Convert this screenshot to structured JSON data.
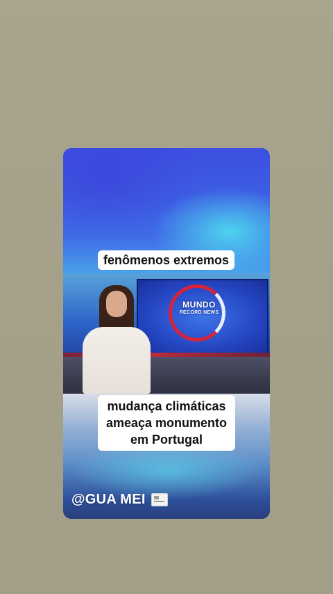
{
  "story": {
    "caption_top": "fenômenos extremos",
    "caption_bottom": "mudança climáticas ameaça monumento em Portugal",
    "video_logo": {
      "line1": "MUNDO",
      "line2": "RECORD NEWS"
    },
    "watermark": "@GUA MEI",
    "watermark_icon": "newspaper-icon"
  },
  "colors": {
    "background": "#a6a28a",
    "caption_bg": "#ffffff",
    "caption_text": "#111111",
    "logo_accent": "#d8243a"
  }
}
